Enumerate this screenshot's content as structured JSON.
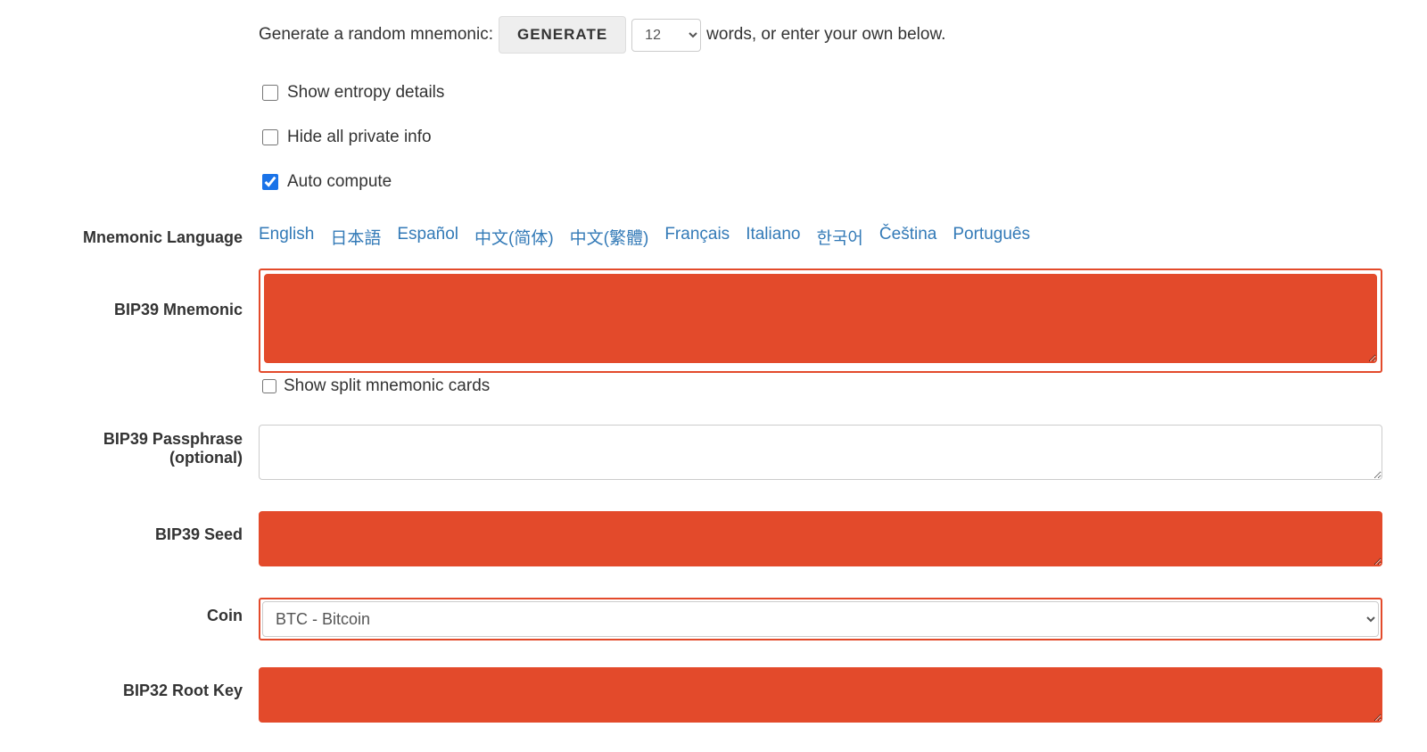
{
  "generate": {
    "prefix": "Generate a random mnemonic:",
    "button": "GENERATE",
    "word_count": "12",
    "suffix": "words, or enter your own below."
  },
  "checkboxes": {
    "show_entropy": {
      "label": "Show entropy details",
      "checked": false
    },
    "hide_private": {
      "label": "Hide all private info",
      "checked": false
    },
    "auto_compute": {
      "label": "Auto compute",
      "checked": true
    }
  },
  "labels": {
    "mnemonic_language": "Mnemonic Language",
    "bip39_mnemonic": "BIP39 Mnemonic",
    "show_split_cards": "Show split mnemonic cards",
    "bip39_passphrase_line1": "BIP39 Passphrase",
    "bip39_passphrase_line2": "(optional)",
    "bip39_seed": "BIP39 Seed",
    "coin": "Coin",
    "bip32_root_key": "BIP32 Root Key"
  },
  "languages": [
    "English",
    "日本語",
    "Español",
    "中文(简体)",
    "中文(繁體)",
    "Français",
    "Italiano",
    "한국어",
    "Čeština",
    "Português"
  ],
  "fields": {
    "bip39_mnemonic": "",
    "bip39_passphrase": "",
    "bip39_seed": "",
    "coin_selected": "BTC - Bitcoin",
    "bip32_root_key": ""
  }
}
